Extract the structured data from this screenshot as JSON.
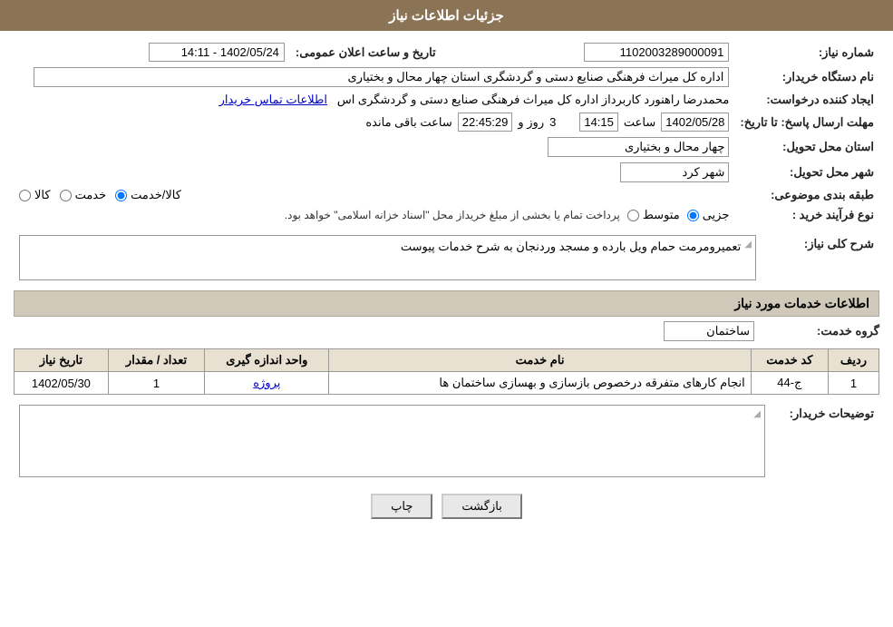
{
  "page": {
    "title": "جزئیات اطلاعات نیاز",
    "sections": {
      "need_info": "جزئیات اطلاعات نیاز",
      "services_info": "اطلاعات خدمات مورد نیاز"
    }
  },
  "fields": {
    "need_number_label": "شماره نیاز:",
    "need_number_value": "1102003289000091",
    "buyer_org_label": "نام دستگاه خریدار:",
    "buyer_org_value": "اداره کل میراث فرهنگی  صنایع دستی و گردشگری استان چهار محال و بختیاری",
    "creator_label": "ایجاد کننده درخواست:",
    "creator_value": "محمدرضا راهنورد کاربرداز اداره کل میراث فرهنگی  صنایع دستی و گردشگری اس",
    "creator_link": "اطلاعات تماس خریدار",
    "announce_date_label": "تاریخ و ساعت اعلان عمومی:",
    "announce_date_value": "1402/05/24 - 14:11",
    "response_date_label": "مهلت ارسال پاسخ: تا تاریخ:",
    "response_date": "1402/05/28",
    "response_time": "14:15",
    "response_days": "3",
    "response_remaining": "22:45:29",
    "response_days_label": "روز و",
    "response_hours_label": "ساعت باقی مانده",
    "response_time_label": "ساعت",
    "province_label": "استان محل تحویل:",
    "province_value": "چهار محال و بختیاری",
    "city_label": "شهر محل تحویل:",
    "city_value": "شهر کرد",
    "category_label": "طبقه بندی موضوعی:",
    "category_options": [
      "کالا",
      "خدمت",
      "کالا/خدمت"
    ],
    "category_selected": "کالا/خدمت",
    "process_type_label": "نوع فرآیند خرید :",
    "process_options": [
      "جزیی",
      "متوسط"
    ],
    "process_note": "پرداخت تمام یا بخشی از مبلغ خریداز محل \"اسناد خزانه اسلامی\" خواهد بود.",
    "description_label": "شرح کلی نیاز:",
    "description_value": "تعمیرومرمت حمام ویل بارده و مسجد وردنجان به شرح خدمات پیوست",
    "service_group_label": "گروه خدمت:",
    "service_group_value": "ساختمان",
    "buyer_notes_label": "توضیحات خریدار:",
    "buyer_notes_value": ""
  },
  "table": {
    "headers": [
      "ردیف",
      "کد خدمت",
      "نام خدمت",
      "واحد اندازه گیری",
      "تعداد / مقدار",
      "تاریخ نیاز"
    ],
    "rows": [
      {
        "row": "1",
        "code": "ج-44",
        "name": "انجام کارهای متفرقه درخصوص بازسازی و بهسازی ساختمان ها",
        "unit": "پروژه",
        "quantity": "1",
        "date": "1402/05/30"
      }
    ]
  },
  "buttons": {
    "print": "چاپ",
    "back": "بازگشت"
  }
}
